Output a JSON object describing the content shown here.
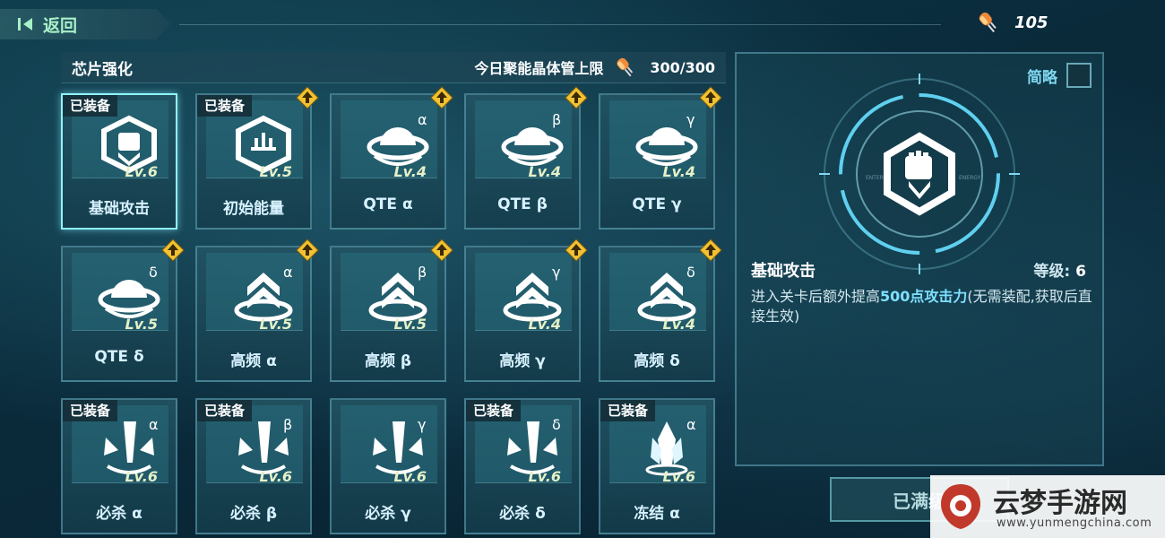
{
  "header": {
    "back_label": "返回",
    "currency_value": "105"
  },
  "panel": {
    "title": "芯片强化",
    "limit_label": "今日聚能晶体管上限",
    "limit_count": "300/300"
  },
  "chips": [
    {
      "name": "基础攻击",
      "level": "Lv.6",
      "equipped": true,
      "upgrade": false,
      "greek": "",
      "icon": "fist-hex-icon",
      "selected": true
    },
    {
      "name": "初始能量",
      "level": "Lv.5",
      "equipped": true,
      "upgrade": true,
      "greek": "",
      "icon": "energy-hex-icon"
    },
    {
      "name": "QTE α",
      "level": "Lv.4",
      "equipped": false,
      "upgrade": true,
      "greek": "α",
      "icon": "qte-dome-icon"
    },
    {
      "name": "QTE β",
      "level": "Lv.4",
      "equipped": false,
      "upgrade": true,
      "greek": "β",
      "icon": "qte-dome-icon"
    },
    {
      "name": "QTE γ",
      "level": "Lv.4",
      "equipped": false,
      "upgrade": true,
      "greek": "γ",
      "icon": "qte-dome-icon"
    },
    {
      "name": "QTE δ",
      "level": "Lv.5",
      "equipped": false,
      "upgrade": true,
      "greek": "δ",
      "icon": "qte-dome-icon"
    },
    {
      "name": "高频 α",
      "level": "Lv.5",
      "equipped": false,
      "upgrade": true,
      "greek": "α",
      "icon": "chevron-ring-icon"
    },
    {
      "name": "高频 β",
      "level": "Lv.5",
      "equipped": false,
      "upgrade": true,
      "greek": "β",
      "icon": "chevron-ring-icon"
    },
    {
      "name": "高频 γ",
      "level": "Lv.4",
      "equipped": false,
      "upgrade": true,
      "greek": "γ",
      "icon": "chevron-ring-icon"
    },
    {
      "name": "高频 δ",
      "level": "Lv.4",
      "equipped": false,
      "upgrade": true,
      "greek": "δ",
      "icon": "chevron-ring-icon"
    },
    {
      "name": "必杀 α",
      "level": "Lv.6",
      "equipped": true,
      "upgrade": false,
      "greek": "α",
      "icon": "blade-burst-icon"
    },
    {
      "name": "必杀 β",
      "level": "Lv.6",
      "equipped": true,
      "upgrade": false,
      "greek": "β",
      "icon": "blade-burst-icon"
    },
    {
      "name": "必杀 γ",
      "level": "Lv.6",
      "equipped": false,
      "upgrade": false,
      "greek": "γ",
      "icon": "blade-burst-icon"
    },
    {
      "name": "必杀 δ",
      "level": "Lv.6",
      "equipped": true,
      "upgrade": false,
      "greek": "δ",
      "icon": "blade-burst-icon"
    },
    {
      "name": "冻结 α",
      "level": "Lv.6",
      "equipped": true,
      "upgrade": false,
      "greek": "α",
      "icon": "ice-crystal-icon"
    }
  ],
  "equipped_label": "已装备",
  "detail": {
    "brief_label": "简略",
    "name": "基础攻击",
    "level_label": "等级:",
    "level_value": "6",
    "desc_prefix": "进入关卡后额外提高",
    "desc_highlight": "500点攻击力",
    "desc_suffix": "(无需装配,获取后直接生效)",
    "ring_text_left": "ENTER",
    "ring_text_right": "ENERGY",
    "maxed_label": "已满级"
  },
  "watermark": {
    "title": "云梦手游网",
    "url": "www.yunmengchina.com"
  },
  "colors": {
    "accent": "#8ef4ff",
    "upgrade_badge": "#f2c230",
    "back_text": "#a8f0c8"
  }
}
